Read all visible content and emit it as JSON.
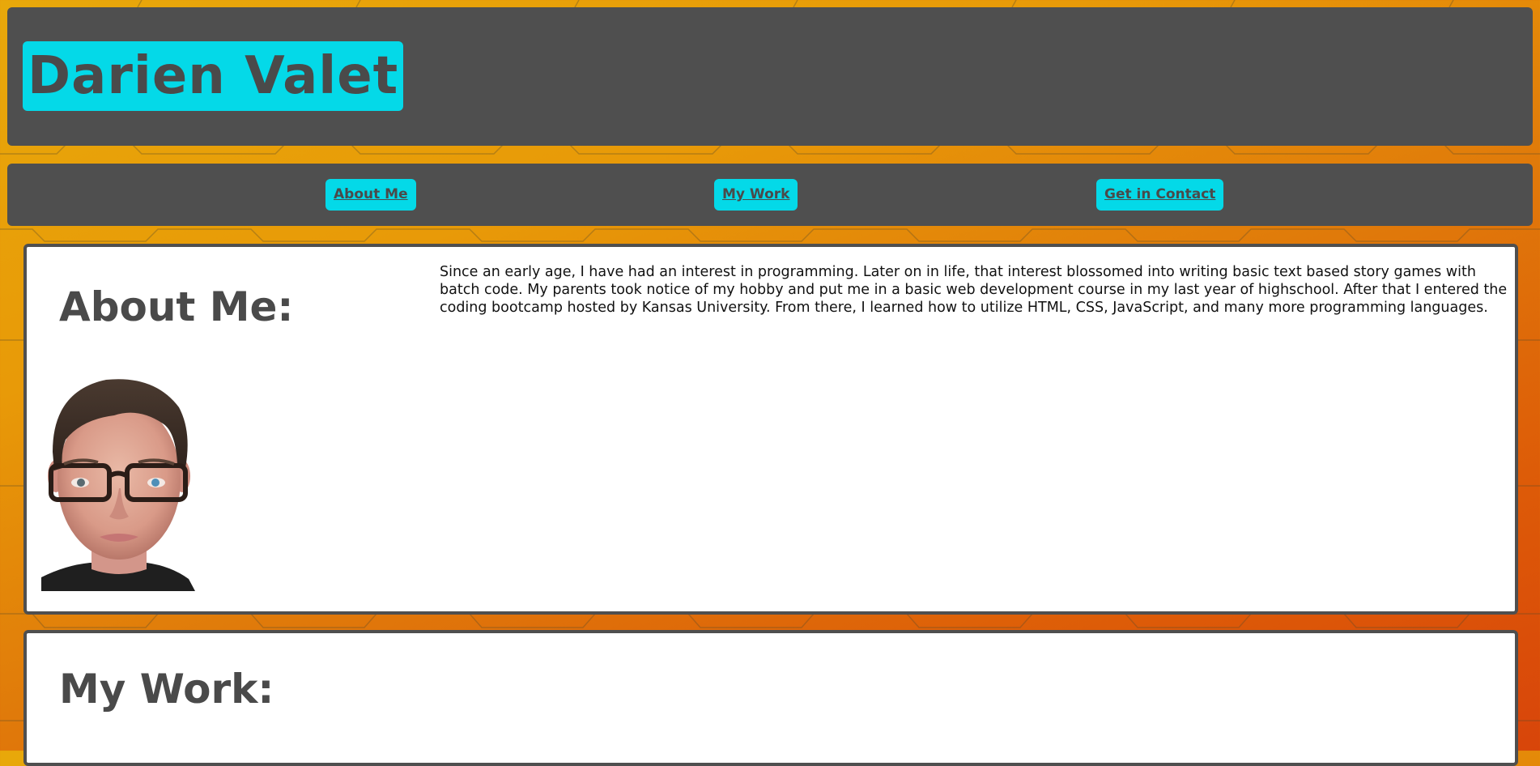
{
  "header": {
    "title": "Darien Valet"
  },
  "nav": {
    "items": [
      {
        "label": "About Me"
      },
      {
        "label": "My Work"
      },
      {
        "label": "Get in Contact"
      }
    ]
  },
  "about": {
    "heading": "About Me:",
    "text": "Since an early age, I have had an interest in programming. Later on in life, that interest blossomed into writing basic text based story games with batch code. My parents took notice of my hobby and put me in a basic web development course in my last year of highschool. After that I entered the coding bootcamp hosted by Kansas University. From there, I learned how to utilize HTML, CSS, JavaScript, and many more programming languages."
  },
  "work": {
    "heading": "My Work:"
  },
  "colors": {
    "accent": "#04d9e8",
    "panel": "#4f4f4f",
    "text": "#4a4a4a",
    "background_start": "#e8a80a",
    "background_end": "#d8450a"
  }
}
